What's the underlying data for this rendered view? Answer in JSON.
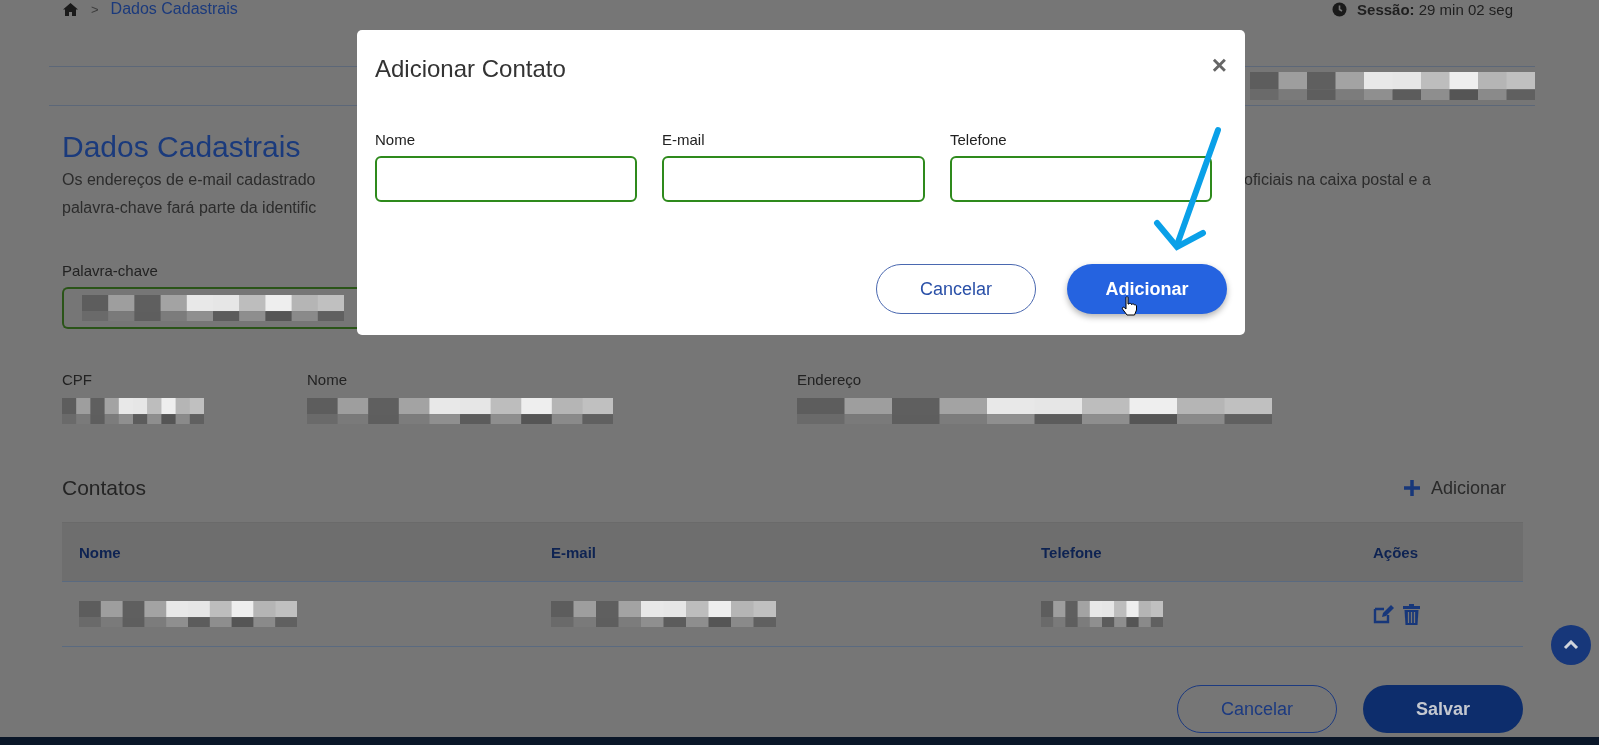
{
  "breadcrumb": {
    "separator": ">",
    "current": "Dados Cadastrais"
  },
  "session": "**Sessão:** 29 min 02 seg",
  "page": {
    "title": "Dados Cadastrais",
    "description_lines": [
      {
        "left": "Os endereços de e-mail cadastrado",
        "right": "oficiais na caixa postal e a"
      },
      {
        "left": "palavra-chave fará parte da identific"
      }
    ],
    "keyword_label": "Palavra-chave",
    "info_fields": [
      {
        "label": "CPF"
      },
      {
        "label": "Nome"
      },
      {
        "label": "Endereço"
      }
    ]
  },
  "contacts": {
    "title": "Contatos",
    "add_label": "Adicionar",
    "columns": [
      "Nome",
      "E-mail",
      "Telefone",
      "Ações"
    ]
  },
  "footer_buttons": [
    {
      "label": "Cancelar",
      "kind": "secondary"
    },
    {
      "label": "Salvar",
      "kind": "primary"
    }
  ],
  "modal": {
    "title": "Adicionar Contato",
    "close": "×",
    "fields": [
      {
        "label": "Nome"
      },
      {
        "label": "E-mail"
      },
      {
        "label": "Telefone"
      }
    ],
    "buttons": [
      {
        "label": "Cancelar",
        "kind": "secondary"
      },
      {
        "label": "Adicionar",
        "kind": "primary"
      }
    ]
  }
}
